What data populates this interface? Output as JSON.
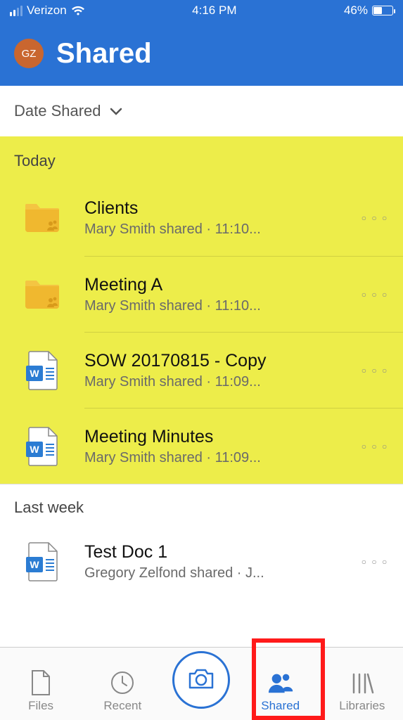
{
  "status": {
    "carrier": "Verizon",
    "time": "4:16 PM",
    "battery_pct": "46%",
    "battery_fill_pct": 46
  },
  "header": {
    "avatar_initials": "GZ",
    "title": "Shared"
  },
  "sort": {
    "label": "Date Shared"
  },
  "sections": [
    {
      "title": "Today",
      "highlight": true,
      "items": [
        {
          "icon": "folder-shared",
          "title": "Clients",
          "sub": "Mary Smith shared · 11:10..."
        },
        {
          "icon": "folder-shared",
          "title": "Meeting A",
          "sub": "Mary Smith shared · 11:10..."
        },
        {
          "icon": "word-doc",
          "title": "SOW 20170815 - Copy",
          "sub": "Mary Smith shared · 11:09..."
        },
        {
          "icon": "word-doc",
          "title": "Meeting Minutes",
          "sub": "Mary Smith shared · 11:09..."
        }
      ]
    },
    {
      "title": "Last week",
      "highlight": false,
      "items": [
        {
          "icon": "word-doc-alt",
          "title": "Test Doc 1",
          "sub": "Gregory Zelfond shared · J..."
        }
      ]
    }
  ],
  "tabs": {
    "files": "Files",
    "recent": "Recent",
    "shared": "Shared",
    "libraries": "Libraries"
  }
}
